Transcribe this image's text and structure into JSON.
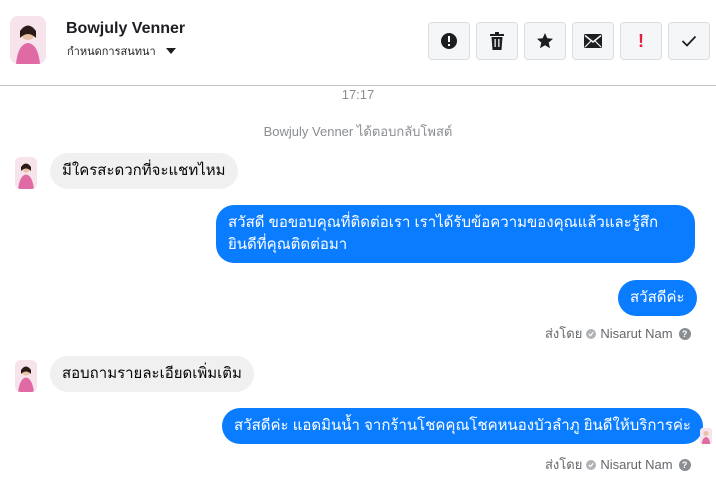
{
  "header": {
    "name": "Bowjuly Venner",
    "subtitle": "กำหนดการสนทนา",
    "actions": [
      {
        "icon": "alert-circle-icon",
        "name": "mark-important-button"
      },
      {
        "icon": "trash-icon",
        "name": "delete-button"
      },
      {
        "icon": "star-icon",
        "name": "star-button"
      },
      {
        "icon": "mail-icon",
        "name": "mark-unread-button"
      },
      {
        "icon": "exclamation-icon",
        "name": "spam-button",
        "label": "!"
      },
      {
        "icon": "check-icon",
        "name": "done-button"
      }
    ]
  },
  "conversation": {
    "time": "17:17",
    "system_note": "Bowjuly Venner ได้ตอบกลับโพสต์",
    "messages": [
      {
        "from": "customer",
        "text": "มีใครสะดวกที่จะแชทไหม"
      },
      {
        "from": "page",
        "text_line1": "สวัสดี ขอขอบคุณที่ติดต่อเรา เราได้รับข้อความของคุณแล้วและรู้สึก",
        "text_line2": "ยินดีที่คุณติดต่อมา"
      },
      {
        "from": "page",
        "text": "สวัสดีค่ะ"
      },
      {
        "from": "customer",
        "text": "สอบถามรายละเอียดเพิ่มเติม"
      },
      {
        "from": "page",
        "text": "สวัสดีค่ะ แอดมินน้ำ จากร้านโชคคุณโชคหนองบัวลำภู ยินดีให้บริการค่ะ"
      }
    ],
    "sent_by_1": {
      "prefix": "ส่งโดย",
      "name": "Nisarut Nam"
    },
    "sent_by_2": {
      "prefix": "ส่งโดย",
      "name": "Nisarut Nam"
    }
  },
  "colors": {
    "outgoing_bubble": "#0a7cff",
    "incoming_bubble": "#f0f0f0",
    "muted_text": "#8a8d91"
  }
}
